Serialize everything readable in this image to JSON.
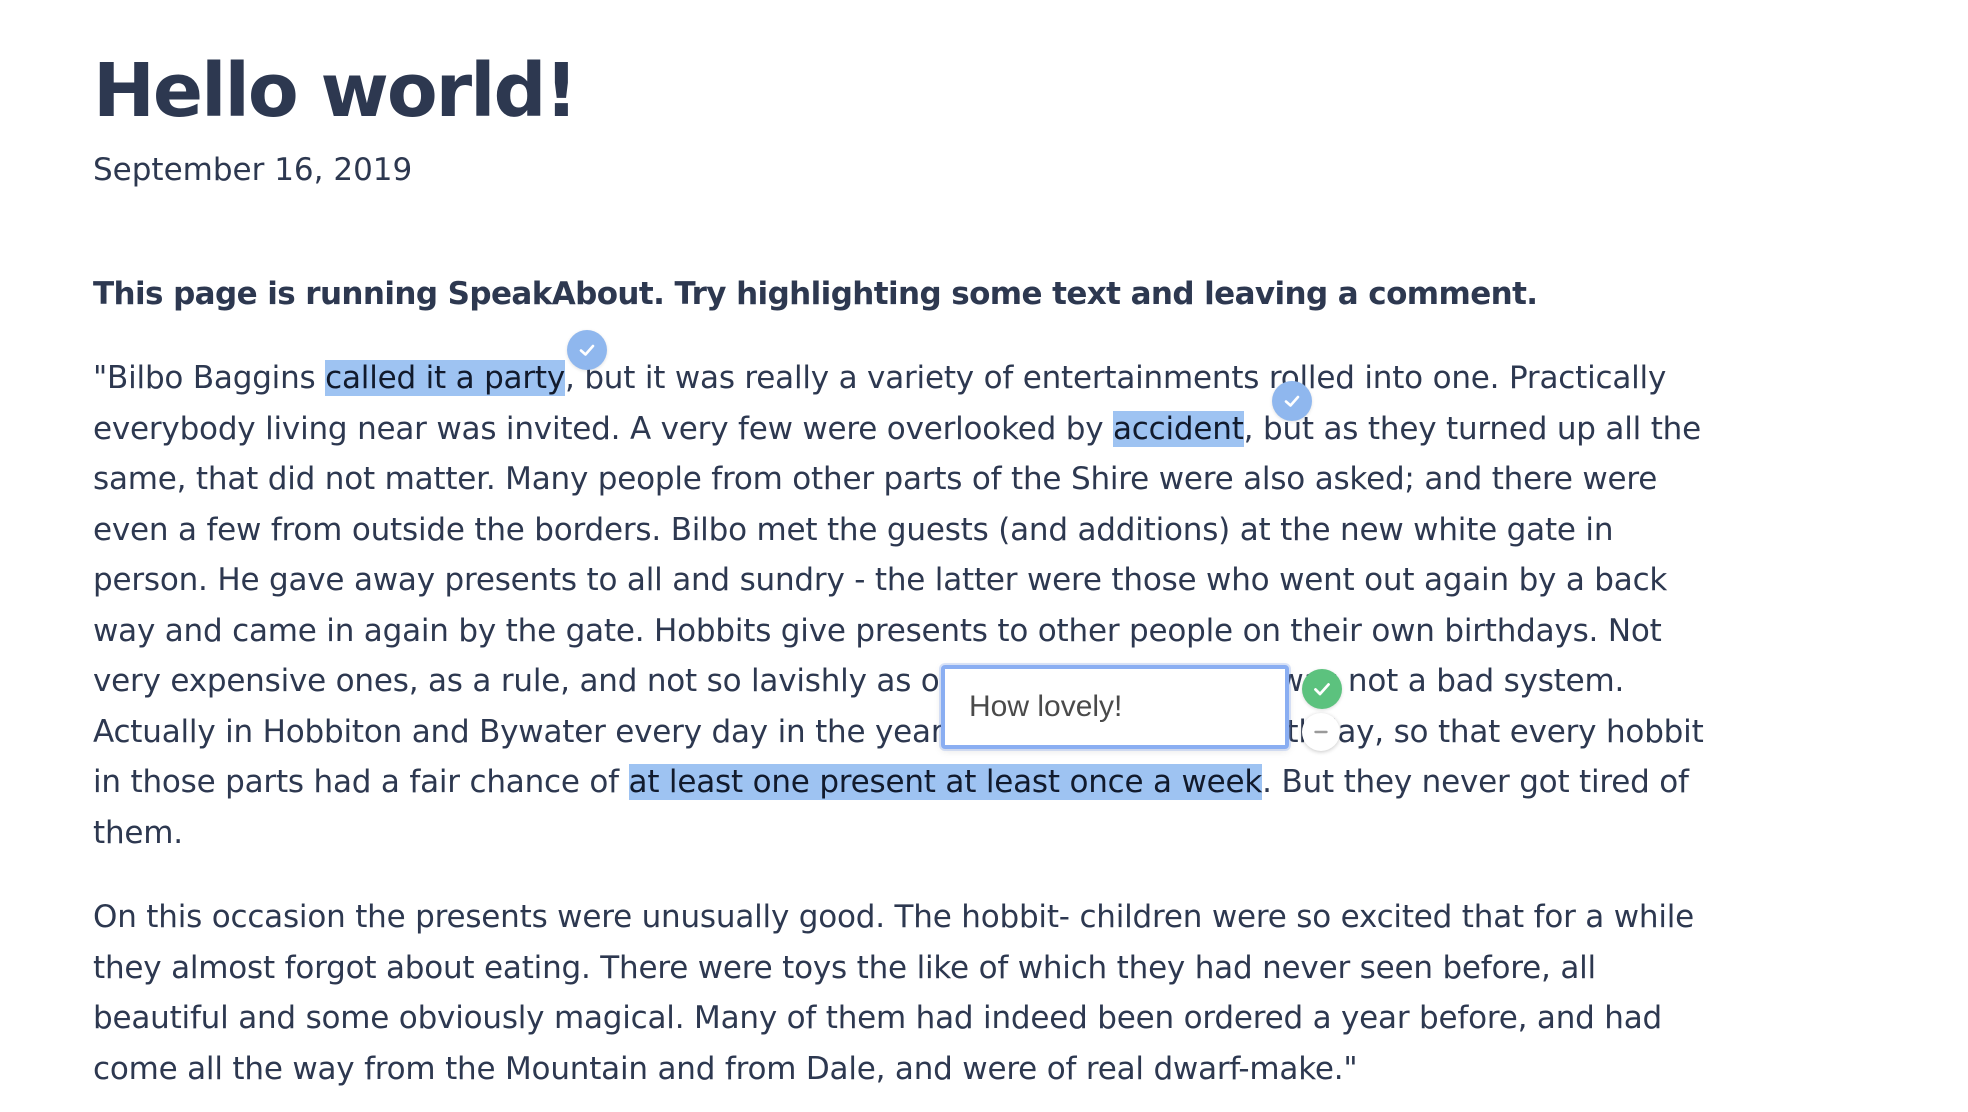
{
  "post": {
    "title": "Hello world!",
    "date": "September 16, 2019",
    "intro": "This page is running SpeakAbout. Try highlighting some text and leaving a comment."
  },
  "paragraph1": {
    "l1_a": "\"Bilbo Baggins ",
    "l1_hl": "called it a party",
    "l1_b": ", but it was really a variety of entertainments rolled into one. Practically",
    "l2_a": "everybody living near was invited. A very few were overlooked by ",
    "l2_hl": "accident",
    "l2_b": ", but as they turned up all the",
    "l3": "same, that did not matter. Many people from other parts of the Shire were also asked; and there were",
    "l4": "even a few from outside the borders. Bilbo met the guests (and additions) at the new white gate in",
    "l5": "person. He gave away presents to all and sundry - the latter were those who went out again by a back",
    "l6": "way and came in again by the gate. Hobbits give presents to other people on their own birthdays. Not",
    "l7": "very expensive ones, as a rule, and not so lavishly as on this occasion; but it was not a bad system.",
    "l8": "Actually in Hobbiton and Bywater every day in the year it was somebody's birthday, so that every hobbit",
    "l9_a": "in those parts had a fair chance of ",
    "l9_hl": "at least one present at least once a week",
    "l9_b": ". But they never got tired of",
    "l10": "them."
  },
  "paragraph2": {
    "l1": "On this occasion the presents were unusually good. The hobbit- children were so excited that for a while",
    "l2": "they almost forgot about eating. There were toys the like of which they had never seen before, all",
    "l3": "beautiful and some obviously magical. Many of them had indeed been ordered a year before, and had",
    "l4": "come all the way from the Mountain and from Dale, and were of real dwarf-make.\""
  },
  "comment": {
    "value": "How lovely!"
  },
  "icons": {
    "highlight_badge": "check-icon",
    "confirm": "check-icon",
    "cancel": "minus-icon"
  },
  "colors": {
    "text": "#2d3850",
    "highlight": "#9ec3f2",
    "badge": "#8fb7ee",
    "confirm": "#5cc27e",
    "comment_border": "#8aaef2"
  }
}
